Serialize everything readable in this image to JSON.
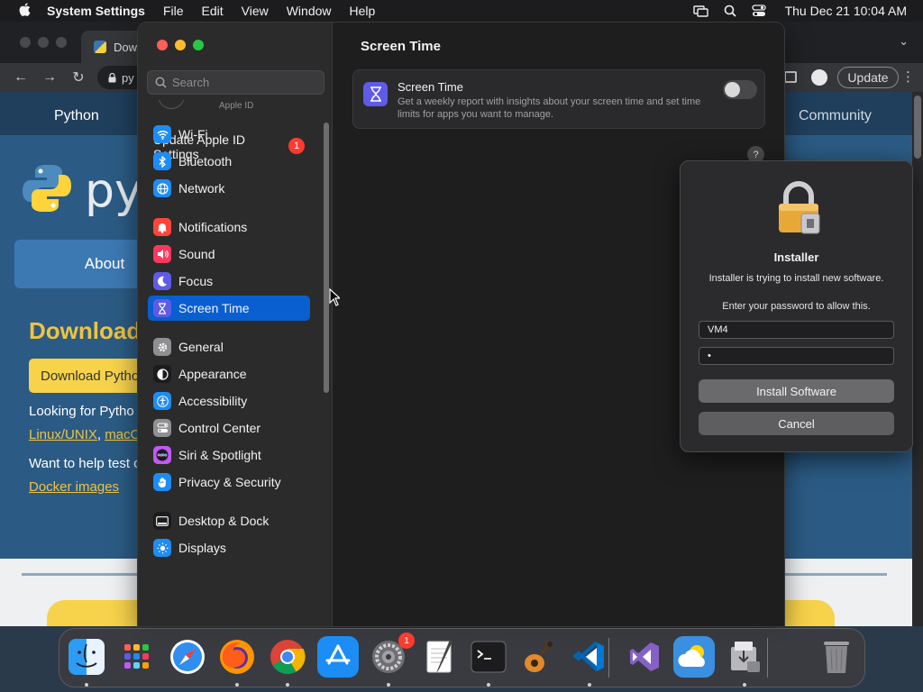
{
  "menubar": {
    "app_name": "System Settings",
    "menus": [
      "File",
      "Edit",
      "View",
      "Window",
      "Help"
    ],
    "clock": "Thu Dec 21  10:04 AM"
  },
  "browser": {
    "tab_title": "Dow",
    "omnibox_text": "py",
    "update_label": "Update",
    "page": {
      "nav_python": "Python",
      "nav_community": "Community",
      "logo_text": "py",
      "about_label": "About",
      "download_heading": "Download",
      "download_button": "Download Pytho",
      "looking_text": "Looking for Pytho",
      "link_linux": "Linux/UNIX",
      "link_sep": ",",
      "link_macos": "macO",
      "want_text": "Want to help test o",
      "docker_link": "Docker images"
    }
  },
  "settings": {
    "search_placeholder": "Search",
    "apple_id_stub": "Apple ID",
    "update_row": {
      "label": "Update Apple ID Settings",
      "badge": "1"
    },
    "sidebar_items": [
      {
        "label": "Wi-Fi",
        "color": "#1e8cf5",
        "icon": "wifi-icon"
      },
      {
        "label": "Bluetooth",
        "color": "#1e8cf5",
        "icon": "bluetooth-icon"
      },
      {
        "label": "Network",
        "color": "#1e8cf5",
        "icon": "globe-icon"
      },
      {
        "label": "Notifications",
        "color": "#ff453a",
        "icon": "bell-icon"
      },
      {
        "label": "Sound",
        "color": "#ff375f",
        "icon": "speaker-icon"
      },
      {
        "label": "Focus",
        "color": "#5e5ce6",
        "icon": "moon-icon"
      },
      {
        "label": "Screen Time",
        "color": "#5e5ce6",
        "icon": "hourglass-icon",
        "selected": true
      },
      {
        "label": "General",
        "color": "#8e8e93",
        "icon": "gear-icon"
      },
      {
        "label": "Appearance",
        "color": "#1c1c1e",
        "icon": "appearance-icon"
      },
      {
        "label": "Accessibility",
        "color": "#1e8cf5",
        "icon": "accessibility-icon"
      },
      {
        "label": "Control Center",
        "color": "#8e8e93",
        "icon": "control-center-icon"
      },
      {
        "label": "Siri & Spotlight",
        "color": "#bf5af2",
        "icon": "siri-icon"
      },
      {
        "label": "Privacy & Security",
        "color": "#1e8cf5",
        "icon": "hand-icon"
      },
      {
        "label": "Desktop & Dock",
        "color": "#1c1c1e",
        "icon": "dock-icon"
      },
      {
        "label": "Displays",
        "color": "#1e8cf5",
        "icon": "display-icon"
      }
    ],
    "main_title": "Screen Time",
    "card": {
      "title": "Screen Time",
      "description": "Get a weekly report with insights about your screen time and set time limits for apps you want to manage.",
      "toggle_on": false
    },
    "help_label": "?"
  },
  "installer": {
    "title": "Installer",
    "message": "Installer is trying to install new software.",
    "prompt": "Enter your password to allow this.",
    "username": "VM4",
    "password_dots": "•",
    "install_button": "Install Software",
    "cancel_button": "Cancel"
  },
  "dock": {
    "apps": [
      {
        "name": "finder",
        "color": "#2c9cf4"
      },
      {
        "name": "launchpad",
        "color": "#e4e4e8"
      },
      {
        "name": "safari",
        "color": "#2f8ef0"
      },
      {
        "name": "firefox",
        "color": "#ff7b18"
      },
      {
        "name": "chrome",
        "color": "#ffffff"
      },
      {
        "name": "app-store",
        "color": "#1c8df5"
      },
      {
        "name": "system-settings",
        "color": "#8e8e93",
        "badge": "1"
      },
      {
        "name": "textedit",
        "color": "#f5f5f0"
      },
      {
        "name": "terminal",
        "color": "#1c1c1e"
      },
      {
        "name": "garageband",
        "color": "#c57c2c"
      },
      {
        "name": "vscode",
        "color": "#ffffff"
      },
      {
        "name": "visual-studio",
        "color": "#f5f5f7"
      },
      {
        "name": "weather",
        "color": "#3a8fe0"
      },
      {
        "name": "installer",
        "color": "#d9d9d9"
      },
      {
        "name": "trash",
        "color": "#8a8a8e"
      }
    ]
  }
}
